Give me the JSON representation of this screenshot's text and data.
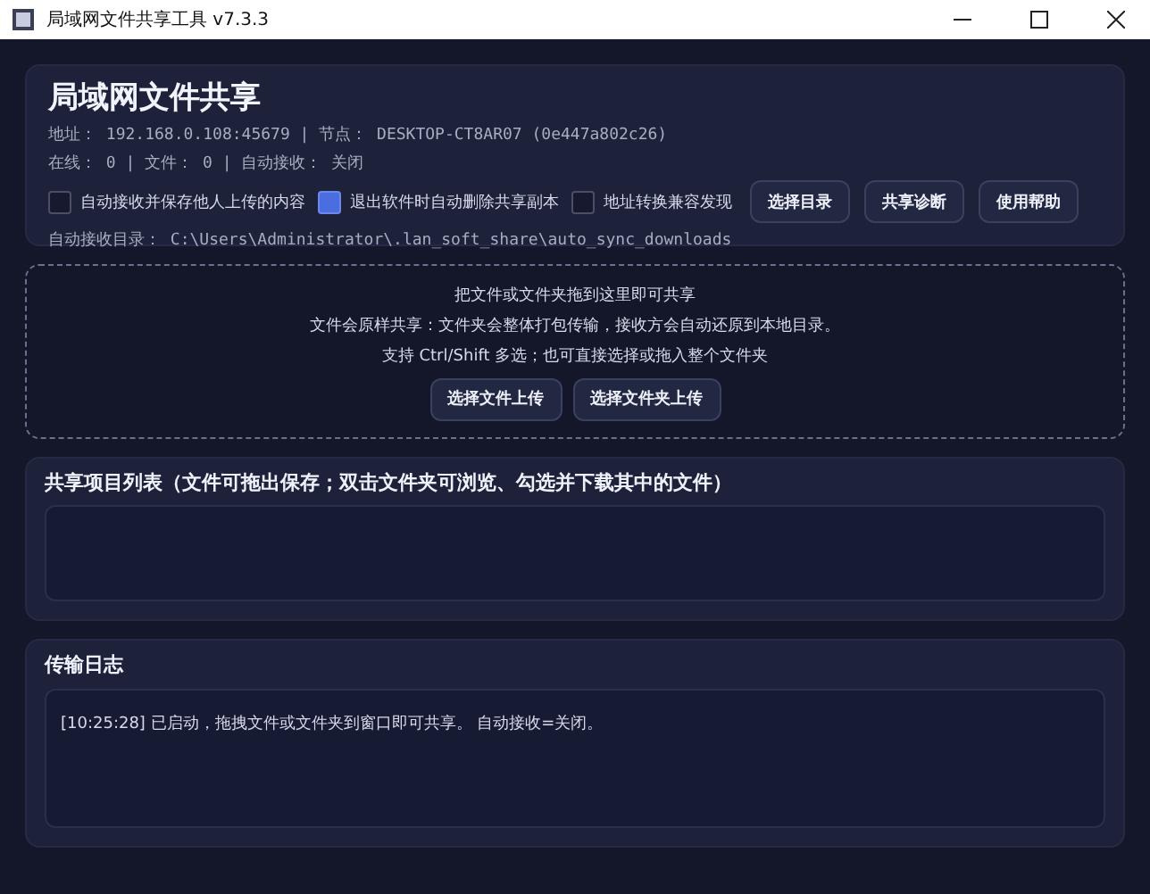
{
  "window": {
    "title": "局域网文件共享工具 v7.3.3"
  },
  "header": {
    "title": "局域网文件共享",
    "address_line": "地址： 192.168.0.108:45679 | 节点： DESKTOP-CT8AR07 (0e447a802c26)",
    "status_line": "在线： 0 | 文件： 0 | 自动接收： 关闭",
    "options": [
      {
        "label": "自动接收并保存他人上传的内容",
        "checked": false
      },
      {
        "label": "退出软件时自动删除共享副本",
        "checked": true
      },
      {
        "label": "地址转换兼容发现",
        "checked": false
      }
    ],
    "buttons": [
      "选择目录",
      "共享诊断",
      "使用帮助"
    ],
    "receive_dir": "自动接收目录： C:\\Users\\Administrator\\.lan_soft_share\\auto_sync_downloads"
  },
  "drop_zone": {
    "lines": [
      "把文件或文件夹拖到这里即可共享",
      "文件会原样共享：文件夹会整体打包传输，接收方会自动还原到本地目录。",
      "支持 Ctrl/Shift 多选；也可直接选择或拖入整个文件夹"
    ],
    "buttons": [
      "选择文件上传",
      "选择文件夹上传"
    ]
  },
  "shared_list": {
    "title": "共享项目列表（文件可拖出保存；双击文件夹可浏览、勾选并下载其中的文件）"
  },
  "log": {
    "title": "传输日志",
    "entries": [
      "[10:25:28] 已启动，拖拽文件或文件夹到窗口即可共享。 自动接收=关闭。"
    ]
  }
}
